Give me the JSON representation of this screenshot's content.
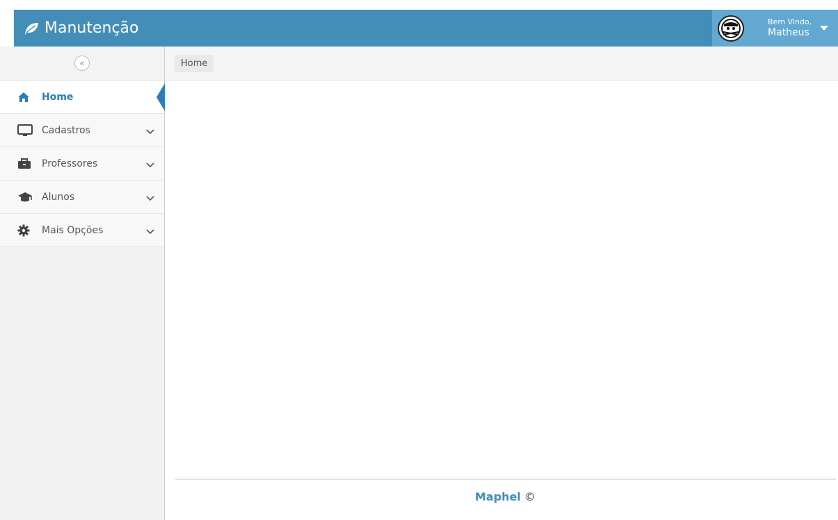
{
  "app": {
    "title": "Manutenção",
    "brand_icon": "leaf-icon",
    "accent_color": "#438eb9"
  },
  "user": {
    "greeting": "Bem Vindo,",
    "name": "Matheus",
    "avatar_icon": "avatar-icon"
  },
  "sidebar": {
    "collapse_icon": "double-chevron-left-icon",
    "items": [
      {
        "label": "Home",
        "icon": "home-icon",
        "active": true
      },
      {
        "label": "Cadastros",
        "icon": "desktop-icon",
        "active": false
      },
      {
        "label": "Professores",
        "icon": "briefcase-icon",
        "active": false
      },
      {
        "label": "Alunos",
        "icon": "graduation-cap-icon",
        "active": false
      },
      {
        "label": "Mais Opções",
        "icon": "gear-icon",
        "active": false
      }
    ]
  },
  "breadcrumb": {
    "current": "Home"
  },
  "footer": {
    "brand": "Maphel",
    "suffix": " ©"
  }
}
